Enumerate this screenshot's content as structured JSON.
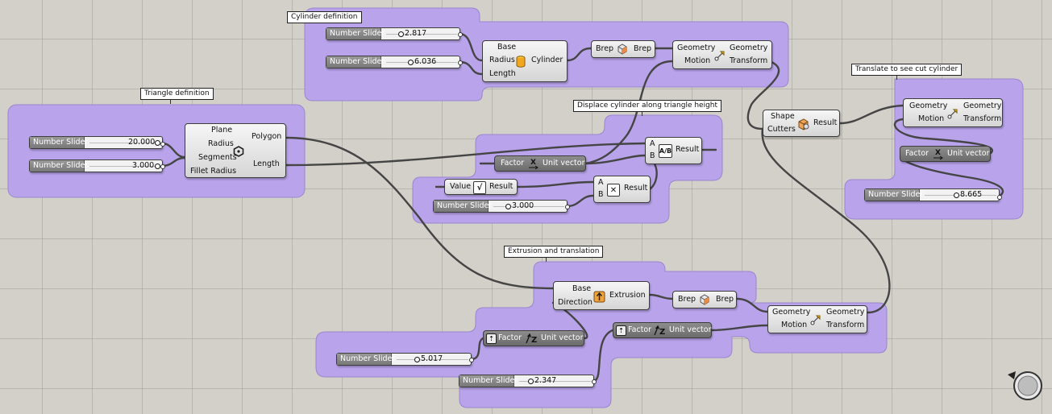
{
  "groups": {
    "cylinder": {
      "title": "Cylinder definition"
    },
    "triangle": {
      "title": "Triangle definition"
    },
    "displace": {
      "title": "Displace cylinder along triangle height"
    },
    "extrusion": {
      "title": "Extrusion and translation"
    },
    "translate": {
      "title": "Translate to see cut cylinder"
    }
  },
  "sliders": {
    "label": "Number Slider",
    "s1": "2.817",
    "s2": "6.036",
    "s3": "20.000",
    "s4": "3.000",
    "s5": "3.000",
    "s6": "5.017",
    "s7": "2.347",
    "s8": "8.665"
  },
  "components": {
    "cylinder": {
      "base": "Base",
      "radius": "Radius",
      "length": "Length",
      "out": "Cylinder"
    },
    "brep": {
      "in": "Brep",
      "out": "Brep"
    },
    "move": {
      "geometry": "Geometry",
      "motion": "Motion",
      "out_geometry": "Geometry",
      "out_transform": "Transform"
    },
    "polygon": {
      "plane": "Plane",
      "radius": "Radius",
      "segments": "Segments",
      "fillet": "Fillet Radius",
      "out_polygon": "Polygon",
      "out_length": "Length"
    },
    "unitx": {
      "factor": "Factor",
      "out": "Unit vector"
    },
    "unitz": {
      "factor": "Factor",
      "out": "Unit vector"
    },
    "division": {
      "a": "A",
      "b": "B",
      "out": "Result"
    },
    "multiply": {
      "a": "A",
      "b": "B",
      "out": "Result"
    },
    "sqrt": {
      "value": "Value",
      "out": "Result"
    },
    "extrusion": {
      "base": "Base",
      "direction": "Direction",
      "out": "Extrusion"
    },
    "difference": {
      "shape": "Shape",
      "cutters": "Cutters",
      "out": "Result"
    }
  },
  "icons": [
    "cylinder-icon",
    "brep-icon",
    "move-icon",
    "polygon-icon",
    "unit-x-icon",
    "unit-z-icon",
    "division-icon",
    "multiply-icon",
    "sqrt-icon",
    "extrusion-icon",
    "solid-difference-icon",
    "navigation-widget-icon"
  ],
  "colors": {
    "group_fill": "#b9a4eb",
    "group_border": "#9a86cf",
    "canvas": "#d3d0c9",
    "wire": "#444444"
  }
}
